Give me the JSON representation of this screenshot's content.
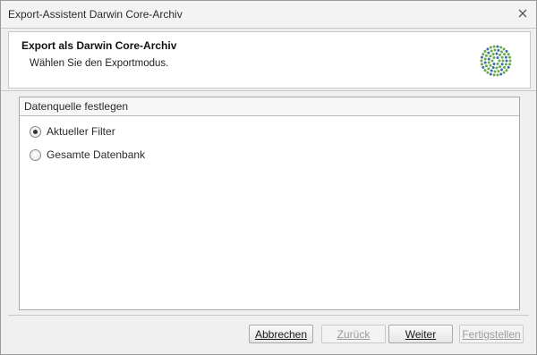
{
  "window": {
    "title": "Export-Assistent Darwin Core-Archiv"
  },
  "header": {
    "title": "Export als Darwin Core-Archiv",
    "subtitle": "Wählen Sie den Exportmodus."
  },
  "group": {
    "title": "Datenquelle festlegen",
    "options": [
      {
        "label": "Aktueller Filter",
        "selected": true
      },
      {
        "label": "Gesamte Datenbank",
        "selected": false
      }
    ]
  },
  "buttons": {
    "cancel": "Abbrechen",
    "back": "Zurück",
    "next": "Weiter",
    "finish": "Fertigstellen"
  },
  "icons": {
    "close": "close-icon",
    "logo": "app-logo-icon"
  },
  "colors": {
    "logo_green": "#6aa84f",
    "logo_blue": "#3a6ea5"
  }
}
